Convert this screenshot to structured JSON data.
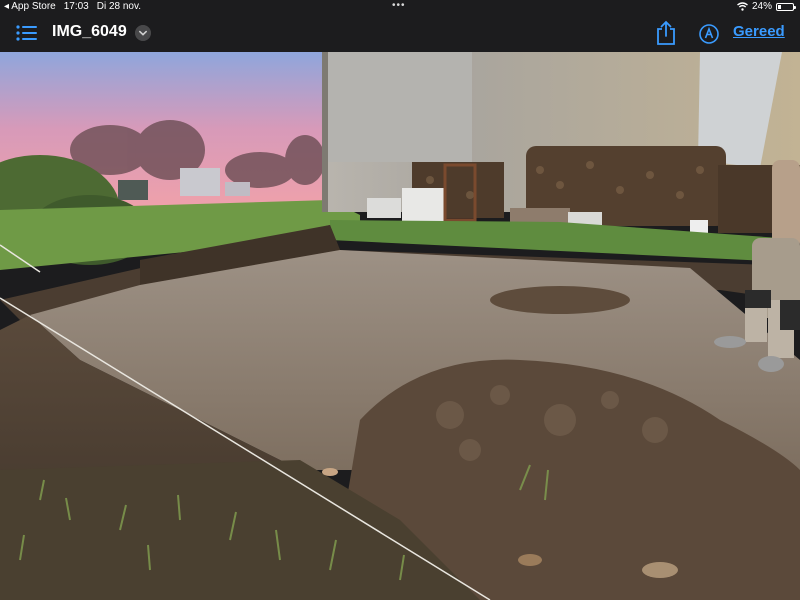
{
  "status_bar": {
    "back_app": "◂ App Store",
    "time": "17:03",
    "date": "Di 28 nov.",
    "battery": "24%",
    "battery_level": 0.24
  },
  "nav_bar": {
    "title": "IMG_6049",
    "done_label": "Gereed"
  },
  "icons": [
    "list-icon",
    "chevron-down-icon",
    "share-icon",
    "markup-icon",
    "wifi-icon",
    "battery-icon"
  ],
  "colors": {
    "accent": "#3a9bff",
    "bar_background": "#1c1c1e"
  }
}
